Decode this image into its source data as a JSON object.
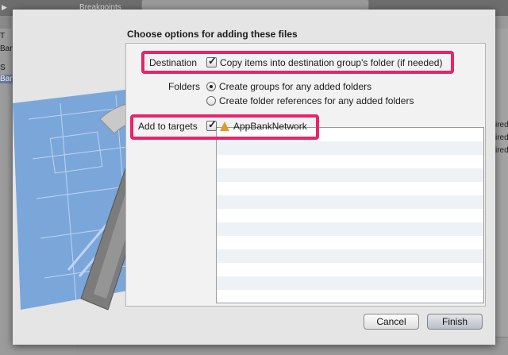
{
  "background": {
    "toolbar_label": "Breakpoints",
    "sidebar_rows": [
      "T",
      "BankNetwork",
      "S",
      "Ban"
    ],
    "right_rows": [
      "ired",
      "ired",
      "ired"
    ]
  },
  "dialog": {
    "title": "Choose options for adding these files",
    "destination": {
      "label": "Destination",
      "option": "Copy items into destination group's folder (if needed)",
      "checked": true
    },
    "folders": {
      "label": "Folders",
      "options": [
        {
          "label": "Create groups for any added folders",
          "selected": true
        },
        {
          "label": "Create folder references for any added folders",
          "selected": false
        }
      ]
    },
    "targets": {
      "label": "Add to targets",
      "items": [
        {
          "name": "AppBankNetwork",
          "checked": true
        }
      ]
    },
    "buttons": {
      "cancel": "Cancel",
      "finish": "Finish"
    }
  },
  "colors": {
    "highlight": "#e8246a",
    "blueprint": "#6e9fd8",
    "icon": "#e09a2a"
  }
}
